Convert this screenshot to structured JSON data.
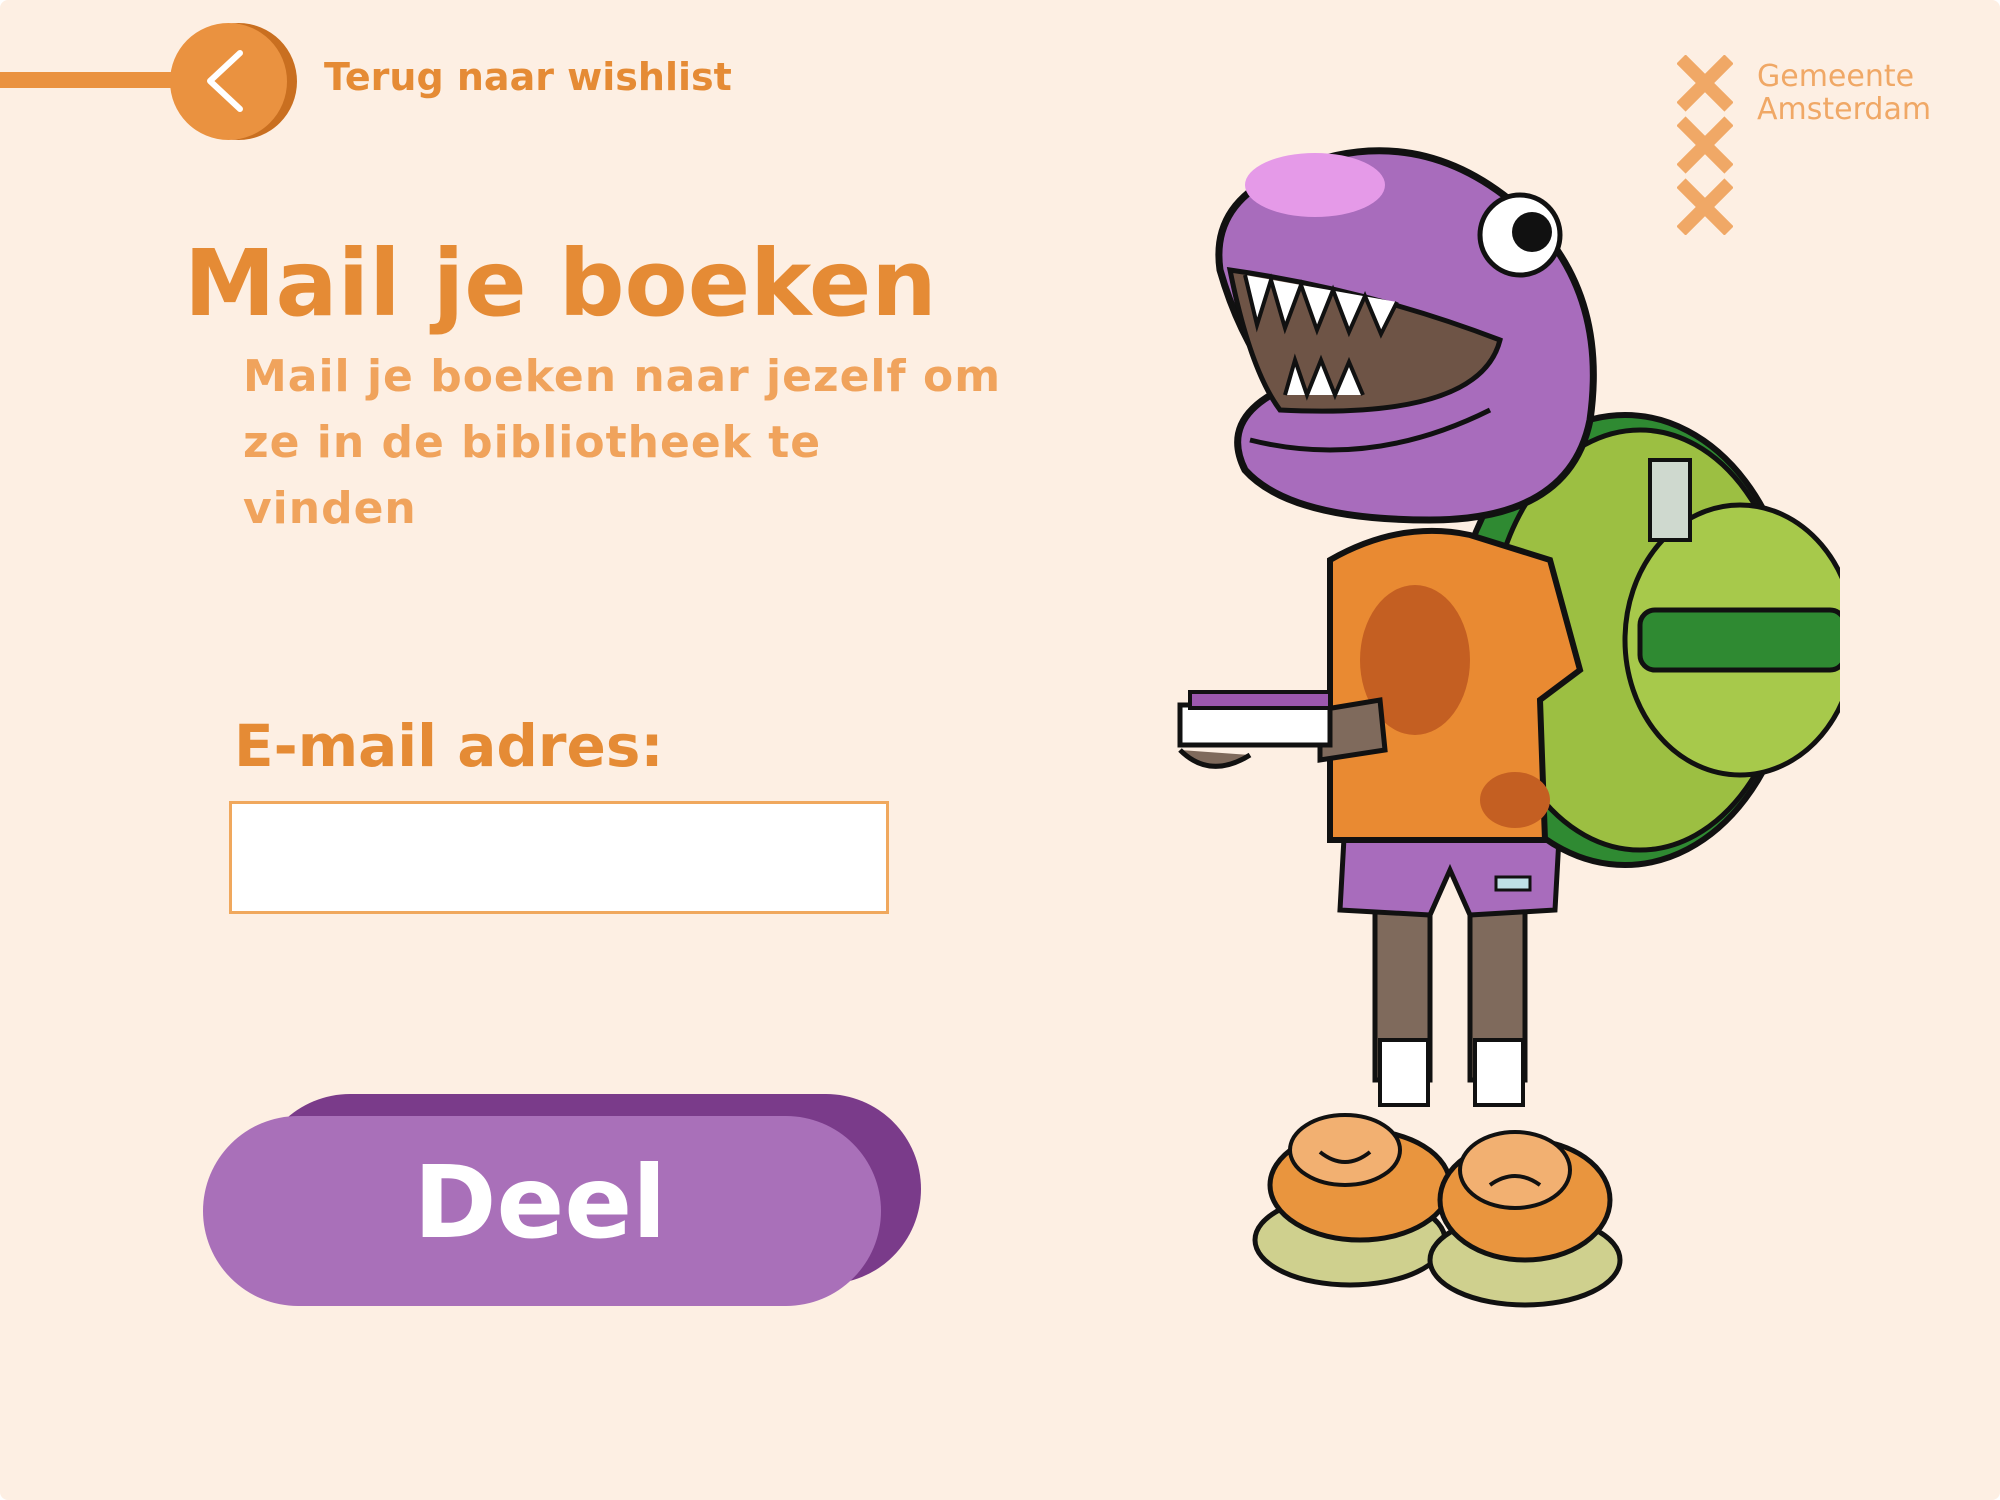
{
  "nav": {
    "back_label": "Terug naar wishlist",
    "back_icon": "chevron-left-icon"
  },
  "logo": {
    "line1": "Gemeente",
    "line2": "Amsterdam",
    "icon": "amsterdam-crosses-icon"
  },
  "main": {
    "title": "Mail je boeken",
    "subtitle": "Mail je boeken naar jezelf om ze in de bibliotheek te vinden",
    "email_label": "E-mail adres:",
    "email_value": "",
    "email_placeholder": "",
    "share_label": "Deel"
  },
  "colors": {
    "background": "#fdefe3",
    "orange": "#e58b35",
    "purple": "#a970b9",
    "purple_dark": "#7a3b8a"
  }
}
